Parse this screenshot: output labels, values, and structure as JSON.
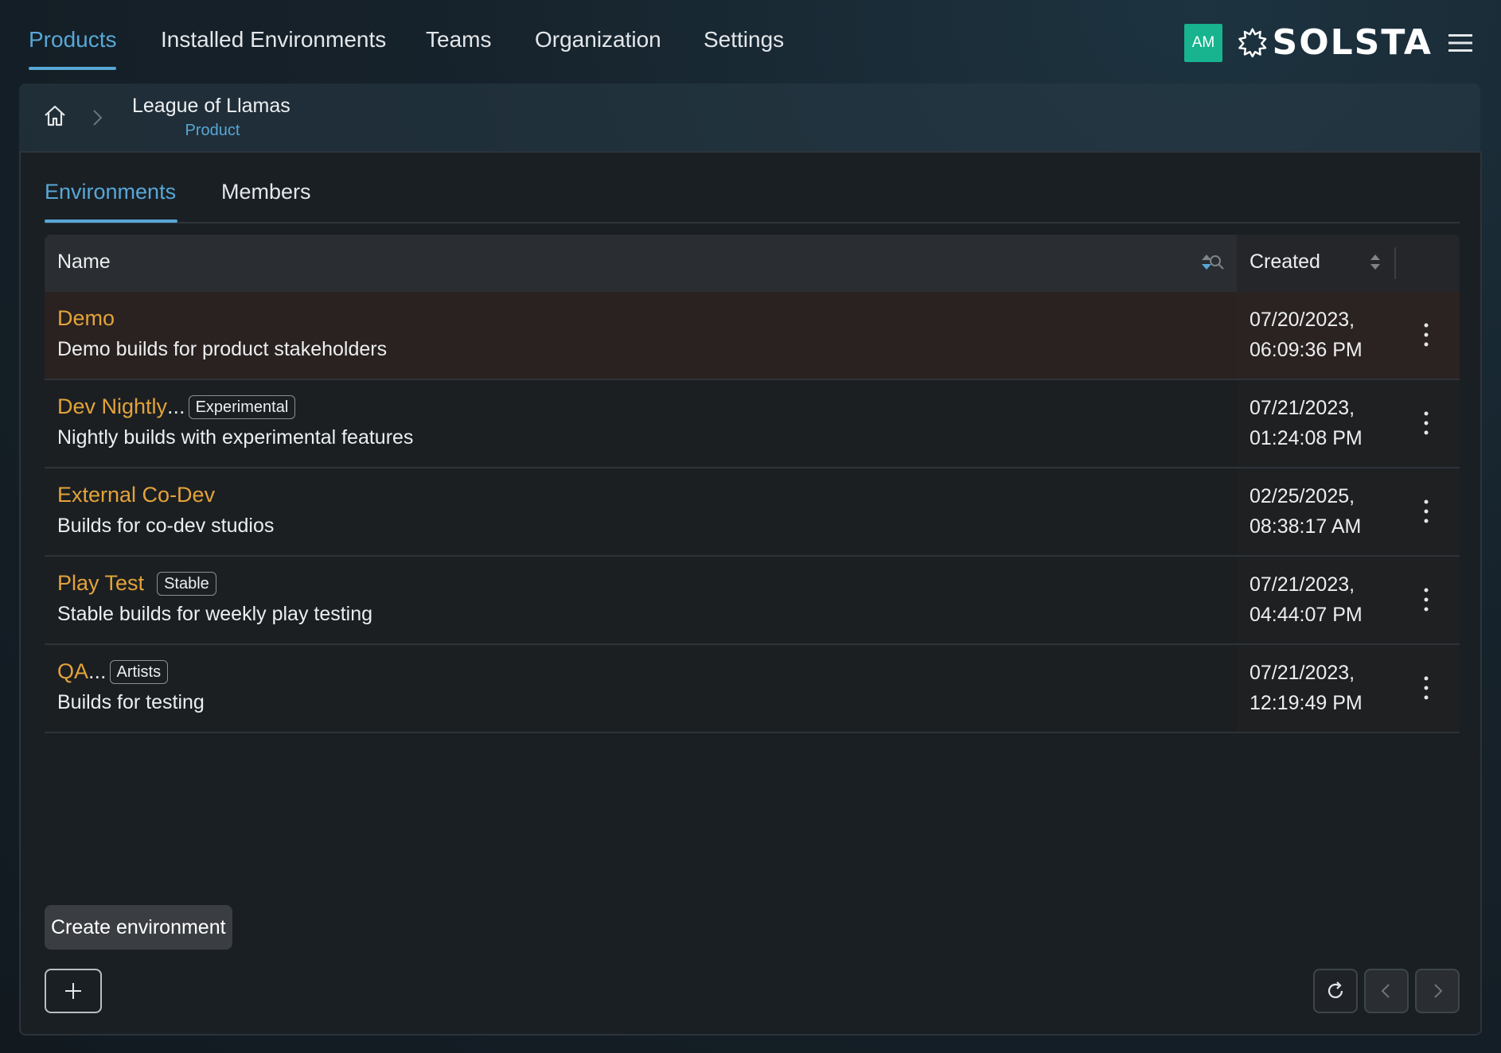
{
  "nav": {
    "tabs": [
      "Products",
      "Installed Environments",
      "Teams",
      "Organization",
      "Settings"
    ],
    "active_tab": "Products",
    "avatar_initials": "AM",
    "logo_text": "SOLSTA",
    "logo_icon": "gear-burst-icon",
    "menu_icon": "hamburger-menu-icon"
  },
  "breadcrumb": {
    "home_icon": "home-icon",
    "separator_icon": "chevron-right-icon",
    "title": "League of Llamas",
    "subtitle": "Product"
  },
  "subtabs": [
    "Environments",
    "Members"
  ],
  "table": {
    "columns": {
      "name": "Name",
      "created": "Created"
    },
    "rows": [
      {
        "name": "Demo",
        "truncated": false,
        "tag": "",
        "description": "Demo builds for product stakeholders",
        "date": "07/20/2023,",
        "time": "06:09:36 PM"
      },
      {
        "name": "Dev Nightly",
        "truncated": true,
        "tag": "Experimental",
        "description": "Nightly builds with experimental features",
        "date": "07/21/2023,",
        "time": "01:24:08 PM"
      },
      {
        "name": "External Co-Dev",
        "truncated": false,
        "tag": "",
        "description": "Builds for co-dev studios",
        "date": "02/25/2025,",
        "time": "08:38:17 AM"
      },
      {
        "name": "Play Test",
        "truncated": false,
        "tag": "Stable",
        "description": "Stable builds for weekly play testing",
        "date": "07/21/2023,",
        "time": "04:44:07 PM"
      },
      {
        "name": "QA",
        "truncated": true,
        "tag": "Artists",
        "description": "Builds for testing",
        "date": "07/21/2023,",
        "time": "12:19:49 PM"
      }
    ]
  },
  "footer": {
    "tooltip": "Create environment",
    "ellipsis": "..."
  },
  "colors": {
    "accent": "#58a7d6",
    "env_name": "#e3a33a",
    "avatar_bg": "#17b48f"
  }
}
